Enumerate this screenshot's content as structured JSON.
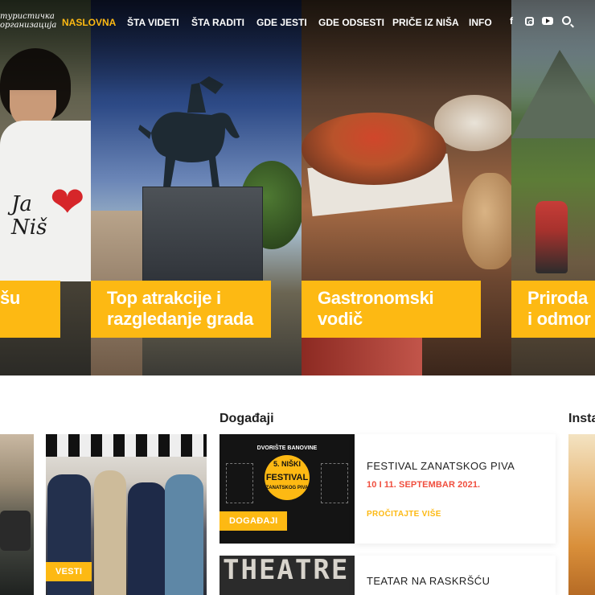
{
  "header": {
    "logo_lines": [
      "туристичка",
      "организација"
    ],
    "nav": [
      {
        "label": "NASLOVNA",
        "active": true
      },
      {
        "label": "ŠTA VIDETI",
        "active": false
      },
      {
        "label": "ŠTA RADITI",
        "active": false
      },
      {
        "label": "GDE JESTI",
        "active": false
      },
      {
        "label": "GDE ODSESTI",
        "active": false
      },
      {
        "label": "PRIČE IZ NIŠA",
        "active": false
      },
      {
        "label": "INFO",
        "active": false
      }
    ],
    "social": {
      "facebook": "f"
    }
  },
  "hero": {
    "panels": [
      {
        "label": "šu"
      },
      {
        "label": "Top atrakcije i razgledanje grada"
      },
      {
        "label": "Gastronomski vodič"
      },
      {
        "label": "Priroda i odmor"
      }
    ],
    "shirt_text": [
      "Ja",
      "Niš"
    ]
  },
  "news": {
    "tag": "VESTI"
  },
  "events": {
    "title": "Događaji",
    "items": [
      {
        "title": "FESTIVAL ZANATSKOG PIVA",
        "date": "10 I 11. SEPTEMBAR 2021.",
        "more": "PROČITAJTE VIŠE",
        "tag": "DOGAĐAJI",
        "poster_lines": [
          "DVORIŠTE BANOVINE",
          "5. NIŠKI",
          "FESTIVAL",
          "ZANATSKOG PIVA"
        ]
      },
      {
        "title": "TEATAR NA RASKRŠĆU",
        "poster_text": "THEATRE"
      }
    ]
  },
  "instagram": {
    "title": "Insta"
  },
  "colors": {
    "accent": "#fdb913",
    "date_red": "#f04e3e",
    "text_dark": "#1f1f1f"
  }
}
